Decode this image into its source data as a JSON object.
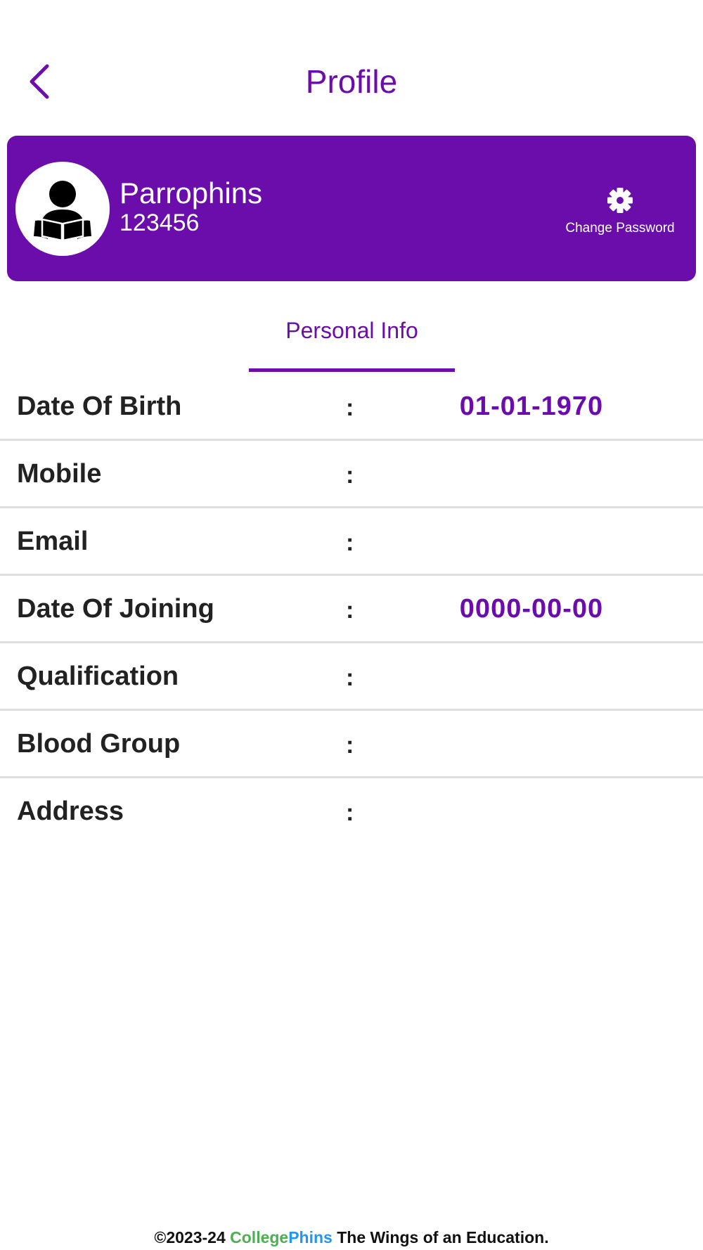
{
  "header": {
    "title": "Profile",
    "back_icon": "chevron-left-icon"
  },
  "profile": {
    "name": "Parrophins",
    "id": "123456",
    "avatar_icon": "student-reading-icon",
    "change_password_label": "Change Password",
    "change_password_icon": "gear-icon"
  },
  "tabs": [
    {
      "label": "Personal Info",
      "active": true
    }
  ],
  "info": [
    {
      "label": "Date Of Birth",
      "colon": ":",
      "value": "01-01-1970"
    },
    {
      "label": "Mobile",
      "colon": ":",
      "value": ""
    },
    {
      "label": "Email",
      "colon": ":",
      "value": ""
    },
    {
      "label": "Date Of Joining",
      "colon": ":",
      "value": "0000-00-00"
    },
    {
      "label": "Qualification",
      "colon": ":",
      "value": ""
    },
    {
      "label": "Blood Group",
      "colon": ":",
      "value": ""
    },
    {
      "label": "Address",
      "colon": ":",
      "value": ""
    }
  ],
  "footer": {
    "prefix": "©2023-24 ",
    "brand_part1": "College",
    "brand_part2": "Phins",
    "suffix": " The Wings of an Education."
  },
  "colors": {
    "accent": "#6a0dab",
    "brand_green": "#4caf50",
    "brand_blue": "#2196f3",
    "divider": "#dedede"
  }
}
